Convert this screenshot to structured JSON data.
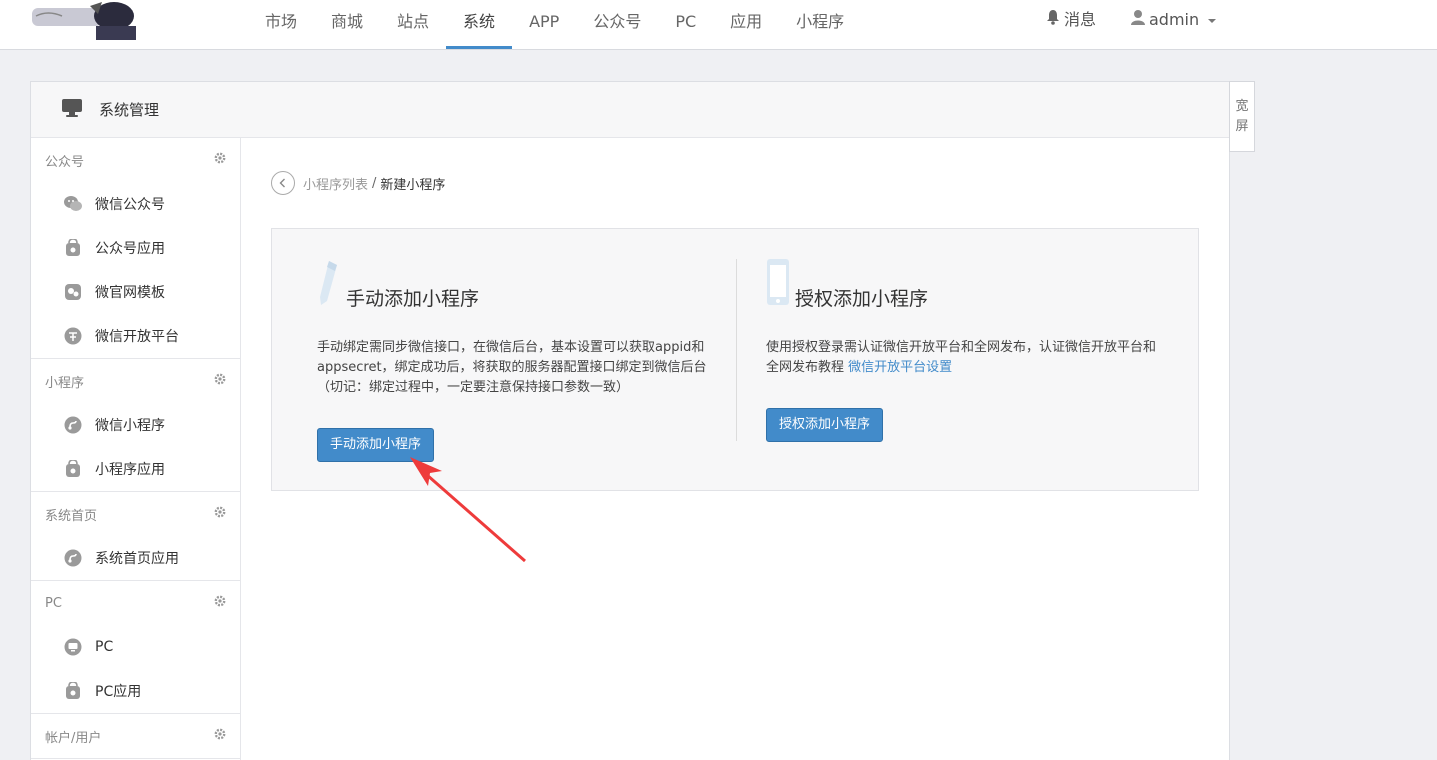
{
  "nav": {
    "items": [
      {
        "label": "市场",
        "active": false
      },
      {
        "label": "商城",
        "active": false
      },
      {
        "label": "站点",
        "active": false
      },
      {
        "label": "系统",
        "active": true
      },
      {
        "label": "APP",
        "active": false
      },
      {
        "label": "公众号",
        "active": false
      },
      {
        "label": "PC",
        "active": false
      },
      {
        "label": "应用",
        "active": false
      },
      {
        "label": "小程序",
        "active": false
      }
    ],
    "messages_label": "消息",
    "user_label": "admin"
  },
  "panel": {
    "title": "系统管理",
    "wide_toggle": [
      "宽",
      "屏"
    ]
  },
  "sidebar": {
    "groups": [
      {
        "title": "公众号",
        "items": [
          {
            "label": "微信公众号",
            "icon": "wechat-icon"
          },
          {
            "label": "公众号应用",
            "icon": "bag-icon"
          },
          {
            "label": "微官网模板",
            "icon": "template-icon"
          },
          {
            "label": "微信开放平台",
            "icon": "platform-icon"
          }
        ]
      },
      {
        "title": "小程序",
        "items": [
          {
            "label": "微信小程序",
            "icon": "miniprogram-icon"
          },
          {
            "label": "小程序应用",
            "icon": "bag-icon"
          }
        ]
      },
      {
        "title": "系统首页",
        "items": [
          {
            "label": "系统首页应用",
            "icon": "miniprogram-icon"
          }
        ]
      },
      {
        "title": "PC",
        "items": [
          {
            "label": "PC",
            "icon": "monitor-icon"
          },
          {
            "label": "PC应用",
            "icon": "bag-icon"
          }
        ]
      },
      {
        "title": "帐户/用户",
        "items": []
      }
    ]
  },
  "breadcrumb": {
    "parent": "小程序列表",
    "separator": "/",
    "current": "新建小程序"
  },
  "cards": {
    "manual": {
      "title": "手动添加小程序",
      "desc": "手动绑定需同步微信接口，在微信后台，基本设置可以获取appid和appsecret，绑定成功后，将获取的服务器配置接口绑定到微信后台（切记：绑定过程中，一定要注意保持接口参数一致）",
      "button": "手动添加小程序"
    },
    "auth": {
      "title": "授权添加小程序",
      "desc": "使用授权登录需认证微信开放平台和全网发布，认证微信开放平台和全网发布教程",
      "link": "微信开放平台设置",
      "button": "授权添加小程序"
    }
  },
  "colors": {
    "accent": "#428bca",
    "annotation_arrow": "#ee3b3b"
  }
}
